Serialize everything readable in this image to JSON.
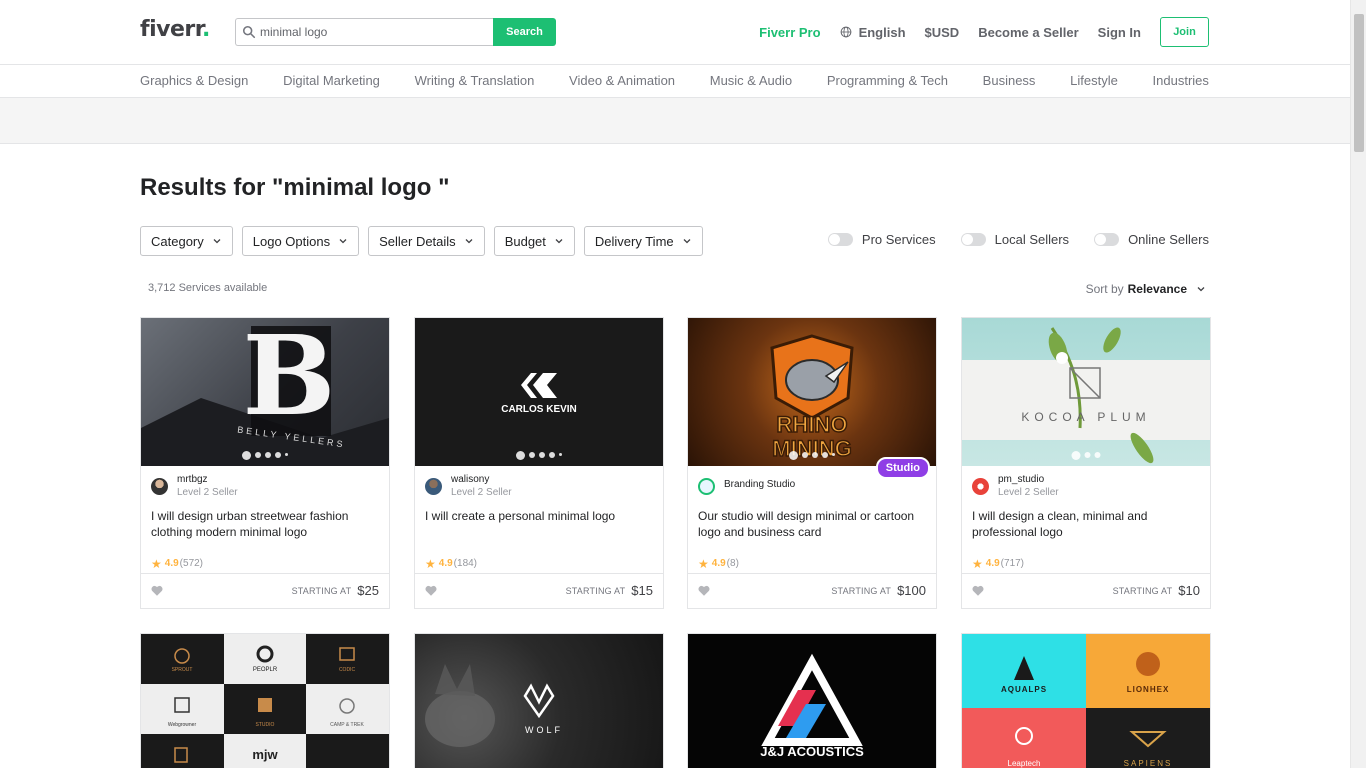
{
  "header": {
    "logo": "fiverr",
    "logo_dot": ".",
    "search_value": "minimal logo",
    "search_button": "Search",
    "nav": {
      "pro": "Fiverr Pro",
      "language": "English",
      "currency": "$USD",
      "become_seller": "Become a Seller",
      "sign_in": "Sign In",
      "join": "Join"
    }
  },
  "categories": [
    "Graphics & Design",
    "Digital Marketing",
    "Writing & Translation",
    "Video & Animation",
    "Music & Audio",
    "Programming & Tech",
    "Business",
    "Lifestyle",
    "Industries"
  ],
  "results": {
    "title": "Results for \"minimal logo \"",
    "count": "3,712 Services available",
    "sort_label": "Sort by",
    "sort_value": "Relevance"
  },
  "filters": [
    "Category",
    "Logo Options",
    "Seller Details",
    "Budget",
    "Delivery Time"
  ],
  "toggles": [
    "Pro Services",
    "Local Sellers",
    "Online Sellers"
  ],
  "gigs": [
    {
      "seller": "mrtbgz",
      "level": "Level 2 Seller",
      "title": "I will design urban streetwear fashion clothing modern minimal logo",
      "rating": "4.9",
      "reviews": "(572)",
      "starting_label": "STARTING AT",
      "price": "$25",
      "image_text": "BELLY YELLERS"
    },
    {
      "seller": "walisony",
      "level": "Level 2 Seller",
      "title": "I will create a personal minimal logo",
      "rating": "4.9",
      "reviews": "(184)",
      "starting_label": "STARTING AT",
      "price": "$15",
      "image_text": "CARLOS KEVIN"
    },
    {
      "seller": "Branding Studio",
      "level": "",
      "title": "Our studio will design minimal or cartoon logo and business card",
      "rating": "4.9",
      "reviews": "(8)",
      "starting_label": "STARTING AT",
      "price": "$100",
      "badge": "Studio",
      "image_text": "RHINO MINING"
    },
    {
      "seller": "pm_studio",
      "level": "Level 2 Seller",
      "title": "I will design a clean, minimal and professional logo",
      "rating": "4.9",
      "reviews": "(717)",
      "starting_label": "STARTING AT",
      "price": "$10",
      "image_text": "KOCOA PLUM"
    }
  ],
  "row2": [
    {
      "image_text": [
        "SPROUT",
        "PEOPLR",
        "CODIC",
        "Webgrowner",
        "STUDIO",
        "CAMP & TREK",
        "",
        "mjw",
        ""
      ]
    },
    {
      "image_text": "WOLF"
    },
    {
      "image_text": "J&J ACOUSTICS"
    },
    {
      "image_text": [
        "AQUALPS",
        "LIONHEX",
        "Leaptech",
        "SAPIENS"
      ]
    }
  ],
  "colors": {
    "accent": "#1dbf73",
    "studio": "#8f3ee6",
    "star": "#ffb33e"
  }
}
